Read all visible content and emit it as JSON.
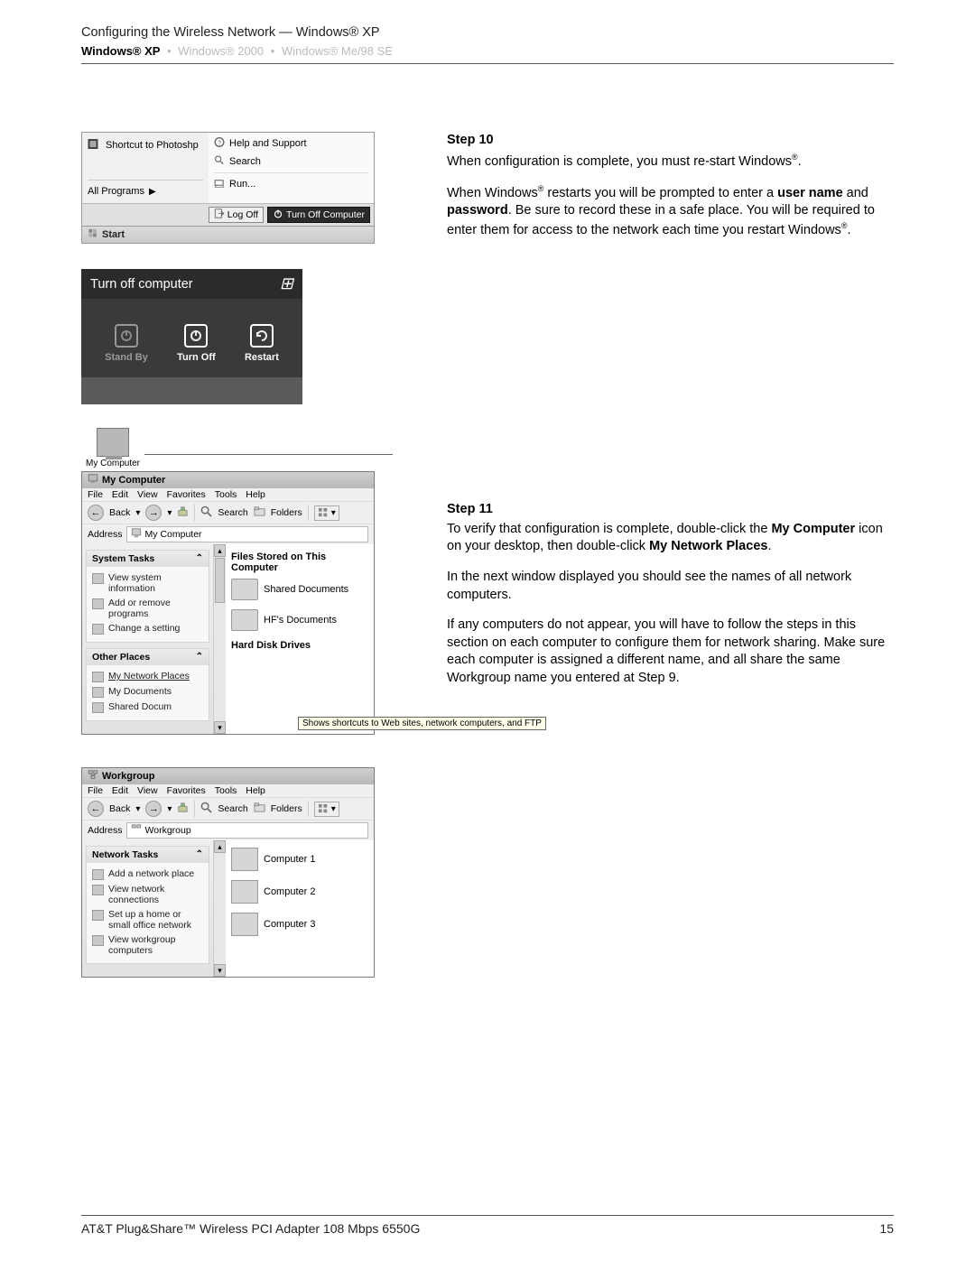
{
  "header": {
    "title": "Configuring the Wireless Network — Windows® XP",
    "breadcrumb": {
      "active": "Windows® XP",
      "item2": "Windows® 2000",
      "item3": "Windows® Me/98 SE"
    }
  },
  "start_menu": {
    "left_item": "Shortcut to Photoshp",
    "all_programs": "All Programs",
    "right_items": {
      "help": "Help and Support",
      "search": "Search",
      "run": "Run..."
    },
    "logoff": "Log Off",
    "turnoff": "Turn Off Computer",
    "start": "Start"
  },
  "turnoff_dialog": {
    "title": "Turn off computer",
    "standby": "Stand By",
    "turnoff": "Turn Off",
    "restart": "Restart"
  },
  "desktop_icon": {
    "label": "My Computer"
  },
  "mycomputer": {
    "title": "My Computer",
    "menu": {
      "file": "File",
      "edit": "Edit",
      "view": "View",
      "favorites": "Favorites",
      "tools": "Tools",
      "help": "Help"
    },
    "toolbar": {
      "back": "Back",
      "search": "Search",
      "folders": "Folders"
    },
    "address_label": "Address",
    "address_value": "My Computer",
    "side": {
      "system_tasks": "System Tasks",
      "view_info": "View system information",
      "add_remove": "Add or remove programs",
      "change_setting": "Change a setting",
      "other_places": "Other Places",
      "my_network": "My Network Places",
      "my_documents": "My Documents",
      "shared_docs": "Shared Docum"
    },
    "content": {
      "files_stored": "Files Stored on This Computer",
      "shared_documents": "Shared Documents",
      "hf_documents": "HF's Documents",
      "hard_drives": "Hard Disk Drives"
    },
    "tooltip": "Shows shortcuts to Web sites, network computers, and FTP"
  },
  "workgroup": {
    "title": "Workgroup",
    "menu": {
      "file": "File",
      "edit": "Edit",
      "view": "View",
      "favorites": "Favorites",
      "tools": "Tools",
      "help": "Help"
    },
    "toolbar": {
      "back": "Back",
      "search": "Search",
      "folders": "Folders"
    },
    "address_label": "Address",
    "address_value": "Workgroup",
    "side": {
      "network_tasks": "Network Tasks",
      "add_place": "Add a network place",
      "view_conn": "View network connections",
      "setup_home": "Set up a home or small office network",
      "view_workgroup": "View workgroup computers"
    },
    "content": {
      "c1": "Computer 1",
      "c2": "Computer 2",
      "c3": "Computer 3"
    }
  },
  "step10": {
    "heading": "Step 10",
    "p1_a": "When configuration is complete, you must re-start Windows",
    "p1_b": ".",
    "p2_a": "When Windows",
    "p2_b": " restarts you will be prompted to enter a ",
    "p2_c": "user name",
    "p2_d": " and ",
    "p2_e": "password",
    "p2_f": ". Be sure to record these in a safe place. You will be required to enter them for access to the network each time you restart Windows",
    "p2_g": "."
  },
  "step11": {
    "heading": "Step 11",
    "p1_a": "To verify that configuration is complete, double-click the ",
    "p1_b": "My Computer",
    "p1_c": " icon on your desktop, then double-click ",
    "p1_d": "My Network Places",
    "p1_e": ".",
    "p2": "In the next window displayed you should see the names of all network computers.",
    "p3": "If any computers do not appear, you will have to follow the steps in this section on each computer to configure them for network sharing. Make sure each computer is assigned a different name, and all share the same Workgroup name you entered at Step 9."
  },
  "footer": {
    "left": "AT&T Plug&Share™ Wireless PCI Adapter 108 Mbps 6550G",
    "right": "15"
  }
}
